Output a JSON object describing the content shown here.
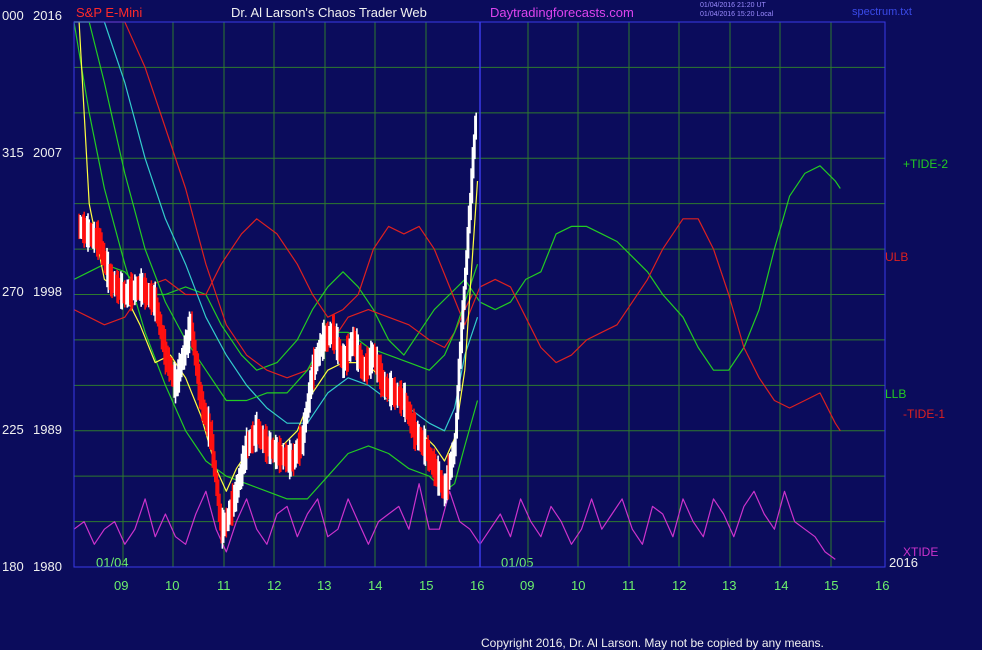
{
  "header": {
    "instrument": "S&P E-Mini",
    "title": "Dr. Al Larson's Chaos Trader Web",
    "site": "Daytradingforecasts.com",
    "timestamp_ut": "01/04/2016 21:20 UT",
    "timestamp_local": "01/04/2016 15:20 Local",
    "file": "spectrum.txt"
  },
  "footer": {
    "copyright": "Copyright 2016, Dr. Al Larson. May not be copied by any means."
  },
  "colors": {
    "background": "#0b0c5c",
    "grid": "#2e7a2e",
    "frame": "#3a3ae8",
    "price_up": "#ffffff",
    "price_down": "#ff1010",
    "tide_plus": "#22cc22",
    "tide_minus": "#dd2020",
    "xtide": "#cc33cc",
    "envelope_green": "#22cc22",
    "envelope_cyan": "#33cccc",
    "envelope_red": "#dd2020",
    "fast_ma": "#ffff40"
  },
  "chart_data": {
    "type": "line",
    "x_axis": {
      "date_labels": [
        "01/04",
        "01/05",
        "2016"
      ],
      "hour_ticks": [
        "09",
        "10",
        "11",
        "12",
        "13",
        "14",
        "15",
        "16",
        "09",
        "10",
        "11",
        "12",
        "13",
        "14",
        "15",
        "16"
      ]
    },
    "y_axis": {
      "ticks": [
        {
          "osc": "000",
          "price": "2016",
          "value": 2016
        },
        {
          "osc": "315",
          "price": "2007",
          "value": 2007
        },
        {
          "osc": "270",
          "price": "1998",
          "value": 1998
        },
        {
          "osc": "225",
          "price": "1989",
          "value": 1989
        },
        {
          "osc": "180",
          "price": "1980",
          "value": 1980
        }
      ],
      "ylim": [
        1980,
        2016
      ]
    },
    "legend_labels": [
      "+TIDE-2",
      "ULB",
      "LLB",
      "-TIDE-1",
      "XTIDE"
    ],
    "series": [
      {
        "name": "S&P E-Mini",
        "hours": [
          8.1,
          8.3,
          8.5,
          8.7,
          9.0,
          9.3,
          9.6,
          9.8,
          10.0,
          10.3,
          10.5,
          10.7,
          10.9,
          11.0,
          11.2,
          11.4,
          11.6,
          11.8,
          12.0,
          12.3,
          12.5,
          12.7,
          12.9,
          13.1,
          13.3,
          13.5,
          13.7,
          13.9,
          14.1,
          14.3,
          14.5,
          14.7,
          14.9,
          15.1,
          15.3,
          15.5,
          15.6,
          15.7,
          15.8,
          15.9,
          15.95
        ],
        "values": [
          2002.5,
          2002.0,
          2001.5,
          1999.0,
          1998.0,
          1998.5,
          1997.5,
          1994.0,
          1992.0,
          1996.0,
          1991.0,
          1988.5,
          1982.5,
          1983.0,
          1985.0,
          1988.0,
          1989.0,
          1988.0,
          1987.5,
          1987.0,
          1988.5,
          1993.0,
          1995.0,
          1995.5,
          1993.5,
          1995.0,
          1993.0,
          1994.0,
          1992.0,
          1991.5,
          1991.0,
          1989.0,
          1988.0,
          1986.5,
          1985.0,
          1988.0,
          1994.0,
          1999.0,
          2004.0,
          2009.0,
          2009.5
        ]
      },
      {
        "name": "+TIDE-2",
        "hours": [
          8.0,
          8.3,
          8.6,
          9.0,
          9.4,
          9.8,
          10.2,
          10.6,
          10.9,
          11.3,
          11.6,
          12.0,
          12.4,
          12.7,
          13.0,
          13.3,
          13.6,
          13.9,
          14.2,
          14.5,
          14.8,
          15.1,
          15.4,
          15.7,
          16.0,
          16.3,
          16.6,
          16.9,
          17.2,
          17.5,
          17.8,
          18.1,
          18.4,
          18.7,
          19.0,
          19.3,
          19.6,
          20.0,
          20.3,
          20.6,
          20.9,
          21.2,
          21.5,
          21.8,
          22.1,
          22.4,
          22.7,
          23.0,
          23.1
        ],
        "values": [
          1999.0,
          1999.5,
          2000.0,
          1999.5,
          1998.0,
          1998.0,
          1998.5,
          1998.0,
          1996.0,
          1994.0,
          1993.0,
          1993.5,
          1995.0,
          1997.0,
          1998.5,
          1999.5,
          1998.5,
          1997.0,
          1995.0,
          1994.0,
          1995.5,
          1997.0,
          1998.0,
          1999.0,
          1997.5,
          1997.0,
          1997.5,
          1999.0,
          1999.5,
          2002.0,
          2002.5,
          2002.5,
          2002.0,
          2001.5,
          2000.5,
          1999.5,
          1998.0,
          1996.5,
          1994.5,
          1993.0,
          1993.0,
          1994.5,
          1997.0,
          2001.0,
          2004.5,
          2006.0,
          2006.5,
          2005.5,
          2005.0
        ]
      },
      {
        "name": "-TIDE-1",
        "hours": [
          8.0,
          8.3,
          8.6,
          9.0,
          9.4,
          9.8,
          10.2,
          10.6,
          10.9,
          11.3,
          11.6,
          12.0,
          12.4,
          12.7,
          13.0,
          13.3,
          13.6,
          13.9,
          14.2,
          14.5,
          14.8,
          15.1,
          15.4,
          15.7,
          16.0,
          16.3,
          16.6,
          16.9,
          17.2,
          17.5,
          17.8,
          18.1,
          18.4,
          18.7,
          19.0,
          19.3,
          19.6,
          20.0,
          20.3,
          20.6,
          20.9,
          21.2,
          21.5,
          21.8,
          22.1,
          22.4,
          22.7,
          23.0,
          23.1
        ],
        "values": [
          1997.0,
          1996.5,
          1996.0,
          1996.5,
          1998.5,
          1999.0,
          1998.0,
          1998.0,
          2000.0,
          2002.0,
          2003.0,
          2002.0,
          2000.0,
          1998.0,
          1996.5,
          1997.0,
          1998.0,
          2001.0,
          2002.5,
          2002.0,
          2002.5,
          2001.0,
          1998.5,
          1996.0,
          1998.5,
          1999.0,
          1998.5,
          1996.5,
          1994.5,
          1993.5,
          1994.0,
          1995.0,
          1995.5,
          1996.0,
          1997.5,
          1999.0,
          2001.0,
          2003.0,
          2003.0,
          2001.0,
          1998.0,
          1994.5,
          1992.5,
          1991.0,
          1990.5,
          1991.0,
          1991.5,
          1989.5,
          1989.0
        ]
      },
      {
        "name": "XTIDE",
        "hours": [
          8.0,
          8.2,
          8.4,
          8.6,
          8.8,
          9.0,
          9.2,
          9.4,
          9.6,
          9.8,
          10.0,
          10.2,
          10.4,
          10.6,
          10.8,
          11.0,
          11.2,
          11.4,
          11.6,
          11.8,
          12.0,
          12.2,
          12.4,
          12.6,
          12.8,
          13.0,
          13.2,
          13.4,
          13.6,
          13.8,
          14.0,
          14.2,
          14.4,
          14.6,
          14.8,
          15.0,
          15.2,
          15.4,
          15.6,
          15.8,
          16.0,
          16.2,
          16.4,
          16.6,
          16.8,
          17.0,
          17.2,
          17.4,
          17.6,
          17.8,
          18.0,
          18.2,
          18.4,
          18.6,
          18.8,
          19.0,
          19.2,
          19.4,
          19.6,
          19.8,
          20.0,
          20.2,
          20.4,
          20.6,
          20.8,
          21.0,
          21.2,
          21.4,
          21.6,
          21.8,
          22.0,
          22.2,
          22.4,
          22.6,
          22.8,
          23.0
        ],
        "values": [
          1982.5,
          1983.0,
          1981.5,
          1982.5,
          1983.0,
          1981.5,
          1982.5,
          1984.5,
          1982.0,
          1983.5,
          1982.0,
          1981.5,
          1983.5,
          1985.0,
          1982.5,
          1981.0,
          1983.0,
          1984.5,
          1982.5,
          1981.5,
          1983.5,
          1984.0,
          1982.0,
          1983.5,
          1984.5,
          1982.0,
          1982.5,
          1984.5,
          1983.0,
          1981.5,
          1983.0,
          1983.5,
          1984.0,
          1982.5,
          1985.5,
          1982.5,
          1982.5,
          1985.0,
          1983.0,
          1982.5,
          1981.5,
          1982.5,
          1983.5,
          1982.0,
          1984.5,
          1983.0,
          1982.0,
          1984.0,
          1983.0,
          1981.5,
          1982.5,
          1984.5,
          1982.5,
          1983.5,
          1984.5,
          1982.5,
          1981.5,
          1984.0,
          1983.5,
          1982.0,
          1984.5,
          1983.0,
          1982.0,
          1984.5,
          1983.5,
          1982.0,
          1984.0,
          1985.0,
          1983.5,
          1982.5,
          1985.0,
          1983.0,
          1982.5,
          1982.0,
          1981.0,
          1980.5
        ]
      },
      {
        "name": "ULB",
        "hours": [
          8.0,
          8.3,
          8.6,
          9.0,
          9.4,
          9.8,
          10.2,
          10.6,
          11.0,
          11.4,
          11.8,
          12.2,
          12.6,
          13.0,
          13.4,
          13.8,
          14.2,
          14.6,
          15.0,
          15.3,
          15.5,
          15.7,
          15.85
        ],
        "values": [
          2017.0,
          2017.0,
          2016.5,
          2016.0,
          2013.0,
          2009.0,
          2005.0,
          2000.0,
          1996.0,
          1994.0,
          1993.0,
          1992.5,
          1993.0,
          1994.5,
          1996.5,
          1997.0,
          1996.5,
          1996.0,
          1995.0,
          1994.5,
          1995.5,
          1997.0,
          1998.0
        ]
      },
      {
        "name": "upper cyan",
        "hours": [
          8.0,
          8.3,
          8.6,
          9.0,
          9.4,
          9.8,
          10.2,
          10.6,
          11.0,
          11.4,
          11.8,
          12.2,
          12.6,
          13.0,
          13.4,
          13.8,
          14.2,
          14.6,
          15.0,
          15.3,
          15.5,
          15.7,
          15.95
        ],
        "values": [
          2018.0,
          2017.5,
          2016.5,
          2012.0,
          2007.0,
          2003.0,
          2000.0,
          1996.5,
          1994.0,
          1992.0,
          1990.5,
          1989.5,
          1989.5,
          1991.5,
          1992.5,
          1992.0,
          1991.0,
          1990.5,
          1989.5,
          1989.0,
          1990.5,
          1994.0,
          1996.5
        ]
      },
      {
        "name": "upper green",
        "hours": [
          8.0,
          8.3,
          8.6,
          9.0,
          9.4,
          9.8,
          10.2,
          10.6,
          11.0,
          11.4,
          11.8,
          12.2,
          12.6,
          13.0,
          13.4,
          13.8,
          14.2,
          14.6,
          15.0,
          15.3,
          15.5,
          15.7,
          15.95
        ],
        "values": [
          2018.0,
          2017.5,
          2012.0,
          2006.0,
          2001.0,
          1997.5,
          1995.0,
          1993.0,
          1991.0,
          1991.0,
          1991.5,
          1991.5,
          1993.0,
          1995.5,
          1995.5,
          1994.5,
          1994.0,
          1993.5,
          1993.0,
          1994.0,
          1995.5,
          1997.5,
          2000.0
        ]
      },
      {
        "name": "LLB",
        "hours": [
          8.0,
          8.3,
          8.6,
          9.0,
          9.4,
          9.8,
          10.2,
          10.6,
          11.0,
          11.4,
          11.8,
          12.2,
          12.6,
          13.0,
          13.4,
          13.8,
          14.2,
          14.6,
          15.0,
          15.3,
          15.5,
          15.7,
          15.95
        ],
        "values": [
          2016.0,
          2010.0,
          2005.0,
          2000.0,
          1995.5,
          1992.0,
          1989.0,
          1987.0,
          1986.0,
          1985.5,
          1985.0,
          1984.5,
          1984.5,
          1986.0,
          1987.5,
          1988.0,
          1987.5,
          1986.5,
          1986.0,
          1985.0,
          1985.5,
          1988.0,
          1991.0
        ]
      },
      {
        "name": "fast average",
        "hours": [
          8.1,
          8.3,
          8.6,
          9.0,
          9.3,
          9.6,
          9.9,
          10.2,
          10.5,
          10.8,
          11.0,
          11.2,
          11.5,
          11.8,
          12.1,
          12.4,
          12.7,
          13.0,
          13.3,
          13.6,
          13.9,
          14.2,
          14.5,
          14.8,
          15.1,
          15.3,
          15.5,
          15.7,
          15.95
        ],
        "values": [
          2016.0,
          2004.0,
          1999.0,
          1998.0,
          1996.0,
          1993.5,
          1994.0,
          1992.5,
          1990.0,
          1986.5,
          1985.0,
          1986.5,
          1988.0,
          1988.5,
          1988.0,
          1989.0,
          1991.5,
          1993.0,
          1993.5,
          1993.5,
          1993.0,
          1992.0,
          1990.5,
          1989.0,
          1988.0,
          1987.0,
          1988.5,
          1993.0,
          2005.5
        ]
      }
    ]
  }
}
